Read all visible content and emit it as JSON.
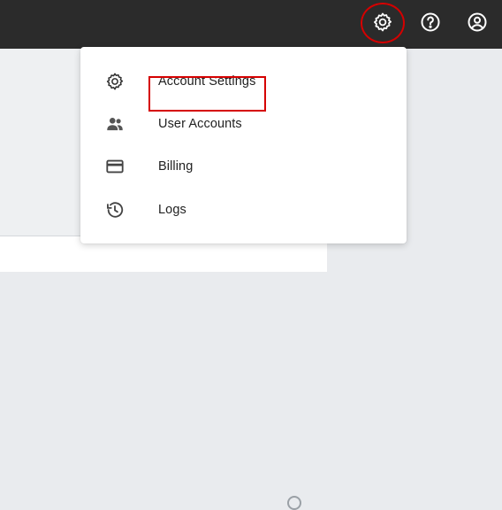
{
  "topbar": {
    "icons": [
      "gear-icon",
      "help-circle-icon",
      "account-circle-icon"
    ],
    "icon_color": "#ffffff",
    "background": "#2b2b2b",
    "highlight_color": "#d50000"
  },
  "menu": {
    "items": [
      {
        "label": "Account Settings",
        "icon": "gear-icon",
        "highlighted": true
      },
      {
        "label": "User Accounts",
        "icon": "users-icon"
      },
      {
        "label": "Billing",
        "icon": "credit-card-icon"
      },
      {
        "label": "Logs",
        "icon": "history-icon"
      }
    ]
  }
}
